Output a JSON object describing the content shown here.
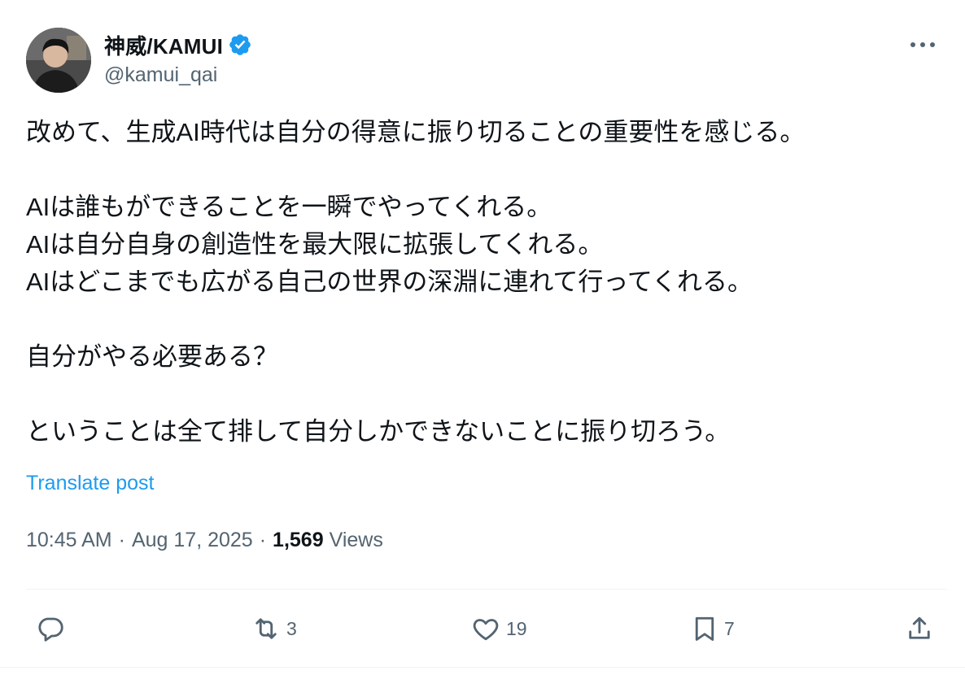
{
  "author": {
    "display_name": "神威/KAMUI",
    "handle": "@kamui_qai",
    "verified": true
  },
  "post": {
    "lines": [
      "改めて、生成AI時代は自分の得意に振り切ることの重要性を感じる。",
      "",
      "AIは誰もができることを一瞬でやってくれる。",
      "AIは自分自身の創造性を最大限に拡張してくれる。",
      "AIはどこまでも広がる自己の世界の深淵に連れて行ってくれる。",
      "",
      "自分がやる必要ある？",
      "",
      "ということは全て排して自分しかできないことに振り切ろう。"
    ],
    "translate_label": "Translate post",
    "time": "10:45 AM",
    "date": "Aug 17, 2025",
    "separator": "·",
    "views_count": "1,569",
    "views_label": "Views"
  },
  "actions": {
    "reply_count": "",
    "repost_count": "3",
    "like_count": "19",
    "bookmark_count": "7"
  },
  "icons": {
    "reply": "reply-icon",
    "repost": "repost-icon",
    "like": "heart-icon",
    "bookmark": "bookmark-icon",
    "share": "share-icon",
    "more": "more-icon",
    "verified": "verified-badge-icon"
  },
  "colors": {
    "accent": "#1d9bf0",
    "text": "#0f1419",
    "muted": "#536471",
    "divider": "#eff3f4"
  }
}
